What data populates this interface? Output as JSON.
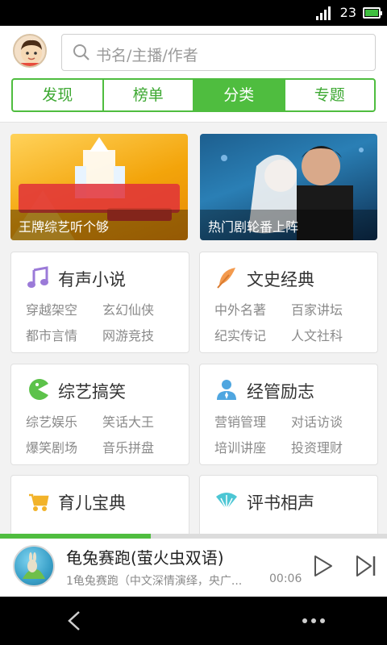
{
  "status": {
    "time": "23",
    "battery_color": "#3fbf3f"
  },
  "search": {
    "placeholder": "书名/主播/作者"
  },
  "tabs": [
    {
      "label": "发现"
    },
    {
      "label": "榜单"
    },
    {
      "label": "分类",
      "active": true
    },
    {
      "label": "专题"
    }
  ],
  "banners": [
    {
      "caption": "王牌综艺听个够"
    },
    {
      "caption": "热门剧轮番上阵"
    }
  ],
  "categories": [
    {
      "title": "有声小说",
      "icon": "music-note-icon",
      "items": [
        "穿越架空",
        "玄幻仙侠",
        "都市言情",
        "网游竞技"
      ]
    },
    {
      "title": "文史经典",
      "icon": "feather-icon",
      "items": [
        "中外名著",
        "百家讲坛",
        "纪实传记",
        "人文社科"
      ]
    },
    {
      "title": "综艺搞笑",
      "icon": "pacman-icon",
      "items": [
        "综艺娱乐",
        "笑话大王",
        "爆笑剧场",
        "音乐拼盘"
      ]
    },
    {
      "title": "经管励志",
      "icon": "person-tie-icon",
      "items": [
        "营销管理",
        "对话访谈",
        "培训讲座",
        "投资理财"
      ]
    },
    {
      "title": "育儿宝典",
      "icon": "stroller-icon",
      "items": []
    },
    {
      "title": "评书相声",
      "icon": "fan-icon",
      "items": []
    }
  ],
  "player": {
    "title": "龟兔赛跑(萤火虫双语)",
    "subtitle": "1龟兔赛跑（中文深情演绎，央广...",
    "time": "00:06",
    "progress": 0.39
  },
  "colors": {
    "accent": "#4fbd3f"
  }
}
